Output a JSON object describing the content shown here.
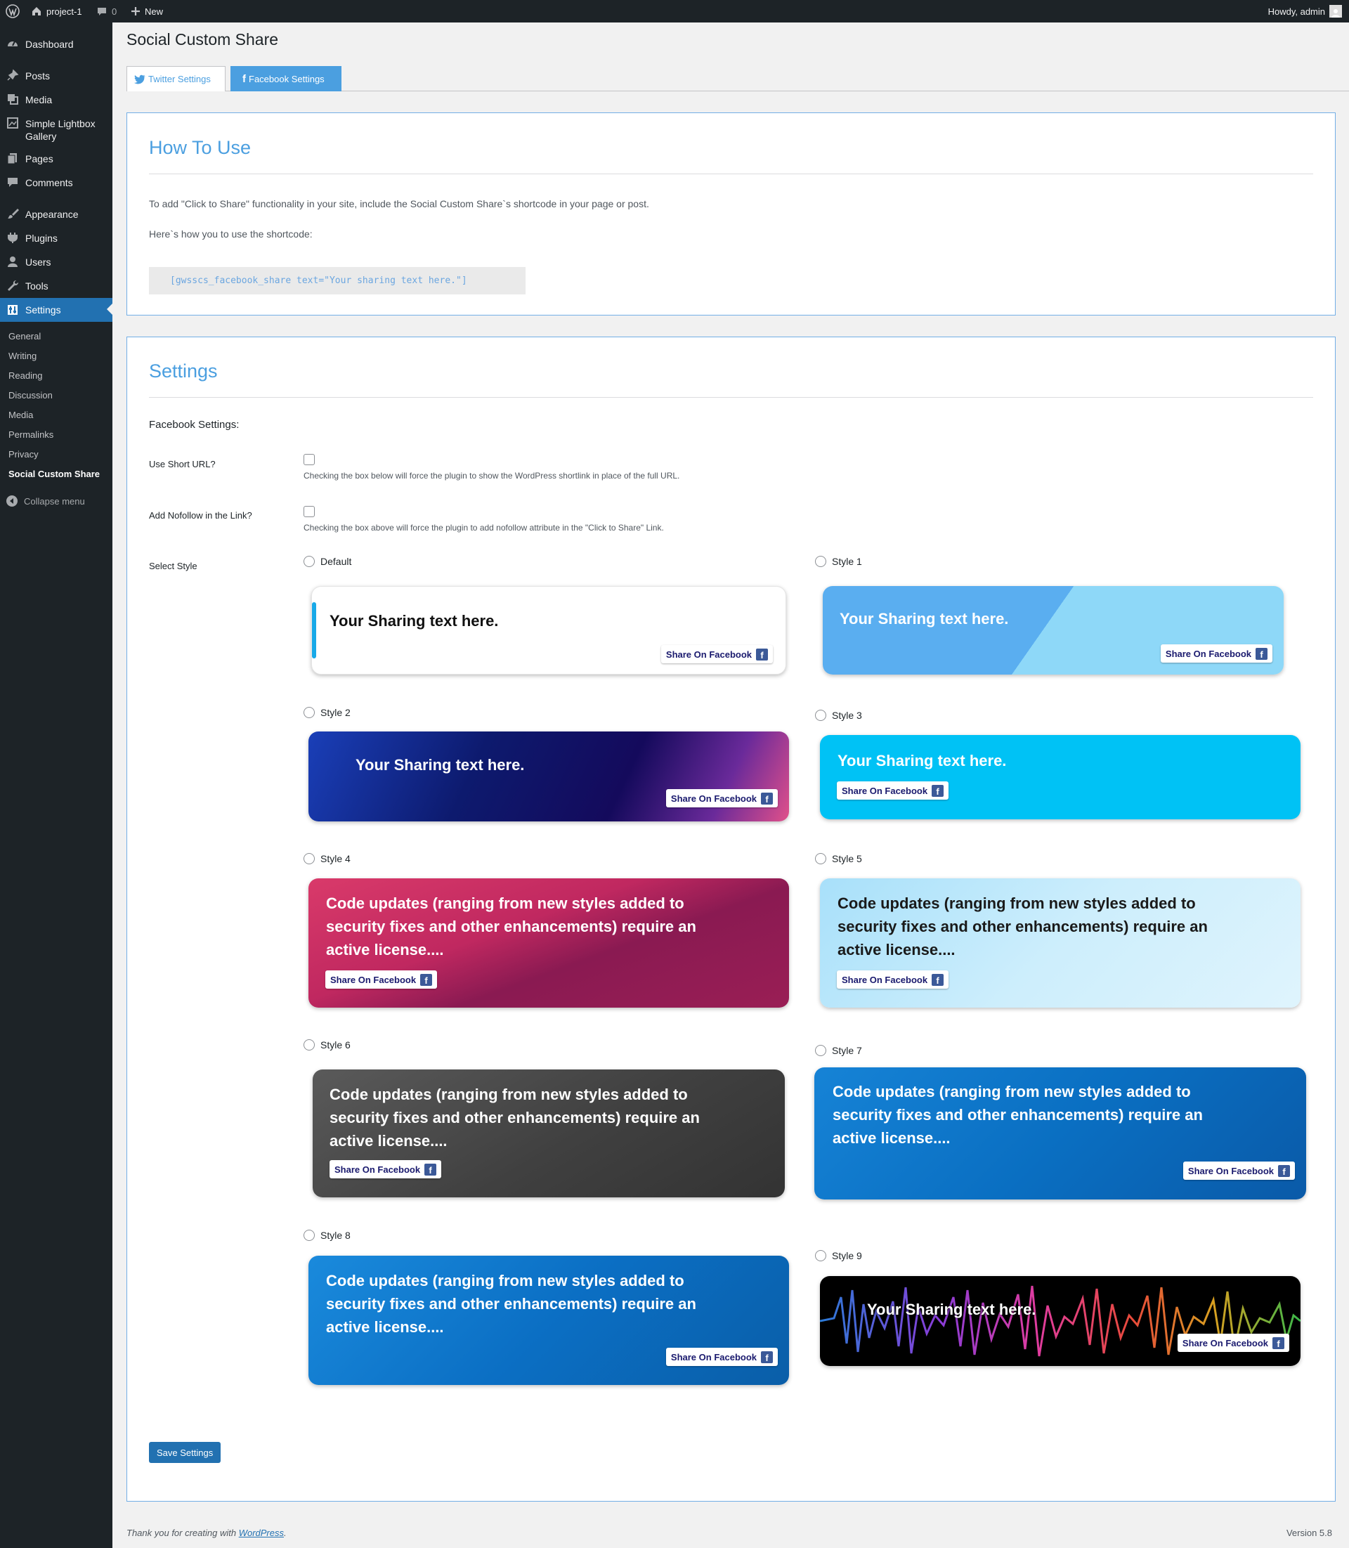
{
  "adminbar": {
    "site_name": "project-1",
    "comments_count": "0",
    "new_label": "New",
    "greeting": "Howdy, admin"
  },
  "sidebar": {
    "items": [
      {
        "label": "Dashboard",
        "icon": "dashboard-icon"
      },
      {
        "label": "Posts",
        "icon": "pin-icon"
      },
      {
        "label": "Media",
        "icon": "media-icon"
      },
      {
        "label": "Simple Lightbox Gallery",
        "icon": "gallery-icon"
      },
      {
        "label": "Pages",
        "icon": "pages-icon"
      },
      {
        "label": "Comments",
        "icon": "comment-icon"
      },
      {
        "label": "Appearance",
        "icon": "brush-icon"
      },
      {
        "label": "Plugins",
        "icon": "plugin-icon"
      },
      {
        "label": "Users",
        "icon": "user-icon"
      },
      {
        "label": "Tools",
        "icon": "wrench-icon"
      },
      {
        "label": "Settings",
        "icon": "settings-icon"
      }
    ],
    "submenu": [
      "General",
      "Writing",
      "Reading",
      "Discussion",
      "Media",
      "Permalinks",
      "Privacy",
      "Social Custom Share"
    ],
    "collapse_label": "Collapse menu"
  },
  "page": {
    "title": "Social Custom Share",
    "tabs": [
      {
        "label": "Twitter Settings",
        "icon": "twitter-icon"
      },
      {
        "label": "Facebook Settings",
        "icon": "facebook-icon"
      }
    ]
  },
  "how_to": {
    "heading": "How To Use",
    "paragraph1": "To add \"Click to Share\" functionality in your site, include the Social Custom Share`s shortcode in your page or post.",
    "paragraph2": "Here`s how you to use the shortcode:",
    "shortcode": "[gwsscs_facebook_share text=\"Your sharing text here.\"]"
  },
  "settings": {
    "heading": "Settings",
    "subheading": "Facebook Settings:",
    "short_url_label": "Use Short URL?",
    "short_url_desc": "Checking the box below will force the plugin to show the WordPress shortlink in place of the full URL.",
    "nofollow_label": "Add Nofollow in the Link?",
    "nofollow_desc": "Checking the box above will force the plugin to add nofollow attribute in the \"Click to Share\" Link.",
    "select_style_label": "Select Style",
    "share_button_label": "Share On Facebook",
    "short_text": "Your Sharing text here.",
    "long_text": "Code updates (ranging from new styles added to security fixes and other enhancements) require an active license....",
    "styles": [
      "Default",
      "Style 1",
      "Style 2",
      "Style 3",
      "Style 4",
      "Style 5",
      "Style 6",
      "Style 7",
      "Style 8",
      "Style 9"
    ],
    "save_label": "Save Settings"
  },
  "footer": {
    "thanks_prefix": "Thank you for creating with ",
    "thanks_link": "WordPress",
    "thanks_suffix": ".",
    "version": "Version 5.8"
  },
  "colors": {
    "accent": "#4b9fe0",
    "admin_blue": "#2271b1",
    "sidebar_bg": "#1d2327"
  }
}
